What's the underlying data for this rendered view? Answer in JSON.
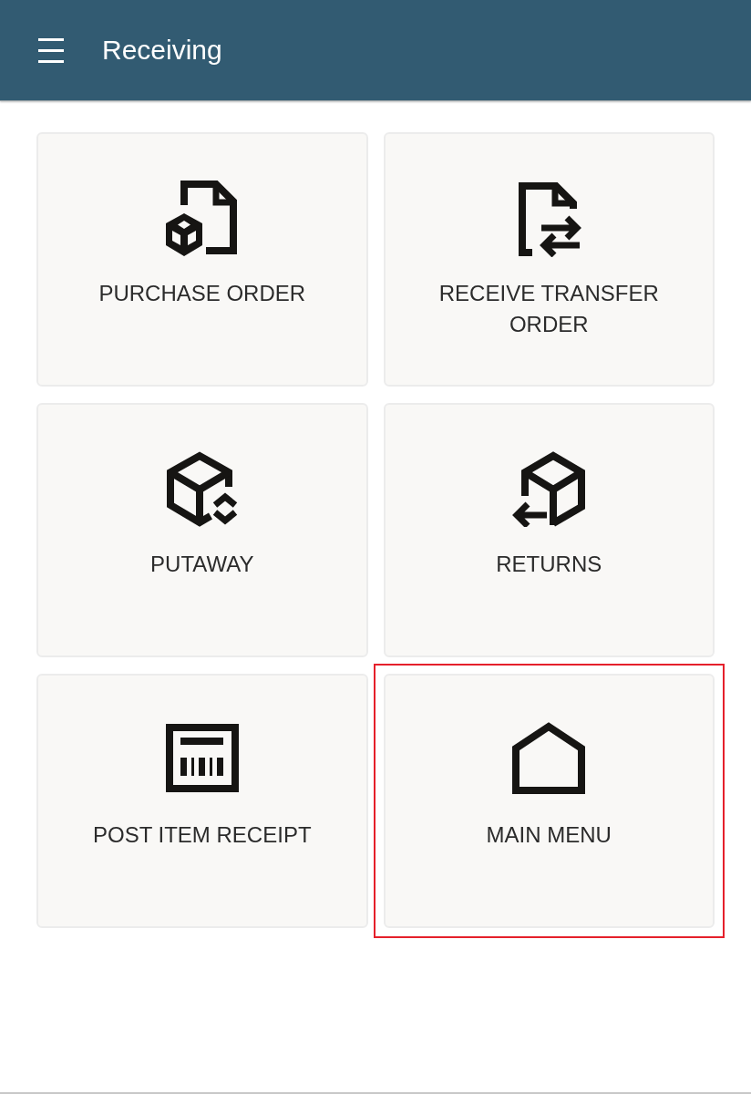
{
  "header": {
    "title": "Receiving"
  },
  "tiles": [
    {
      "kind": "purchase-order",
      "label": "PURCHASE ORDER",
      "highlighted": false
    },
    {
      "kind": "transfer-order",
      "label": "RECEIVE TRANSFER ORDER",
      "highlighted": false
    },
    {
      "kind": "putaway",
      "label": "PUTAWAY",
      "highlighted": false
    },
    {
      "kind": "returns",
      "label": "RETURNS",
      "highlighted": false
    },
    {
      "kind": "receipt",
      "label": "POST ITEM RECEIPT",
      "highlighted": false
    },
    {
      "kind": "home",
      "label": "MAIN MENU",
      "highlighted": true
    }
  ]
}
